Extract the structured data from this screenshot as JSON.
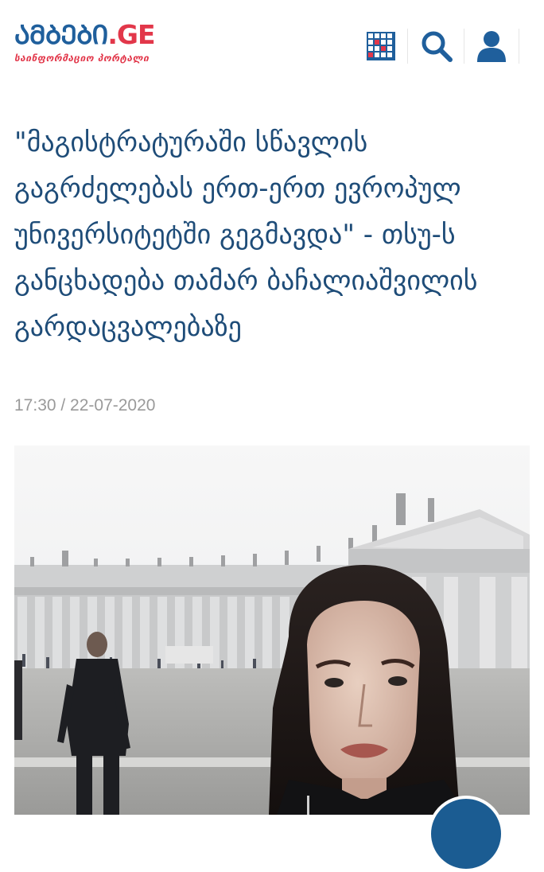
{
  "brand": {
    "logo_main": "ᲐᲛᲑᲔᲑᲘ",
    "logo_suffix": ".GE",
    "tagline": "საინფორმაციო პორტალი"
  },
  "header": {
    "icons": [
      "grid-menu-icon",
      "search-icon",
      "user-icon"
    ]
  },
  "article": {
    "headline": "\"მაგისტრატურაში სწავლის გაგრძელებას ერთ-ერთ ევროპულ უნივერსიტეტში გეგმავდა\" - თსუ-ს განცხადება თამარ ბაჩალიაშვილის გარდაცვალებაზე",
    "datetime": "17:30 / 22-07-2020"
  },
  "colors": {
    "brand_blue": "#1f5f9c",
    "brand_red": "#e2374a",
    "headline_blue": "#1e4c78",
    "meta_gray": "#9a9a9a"
  }
}
